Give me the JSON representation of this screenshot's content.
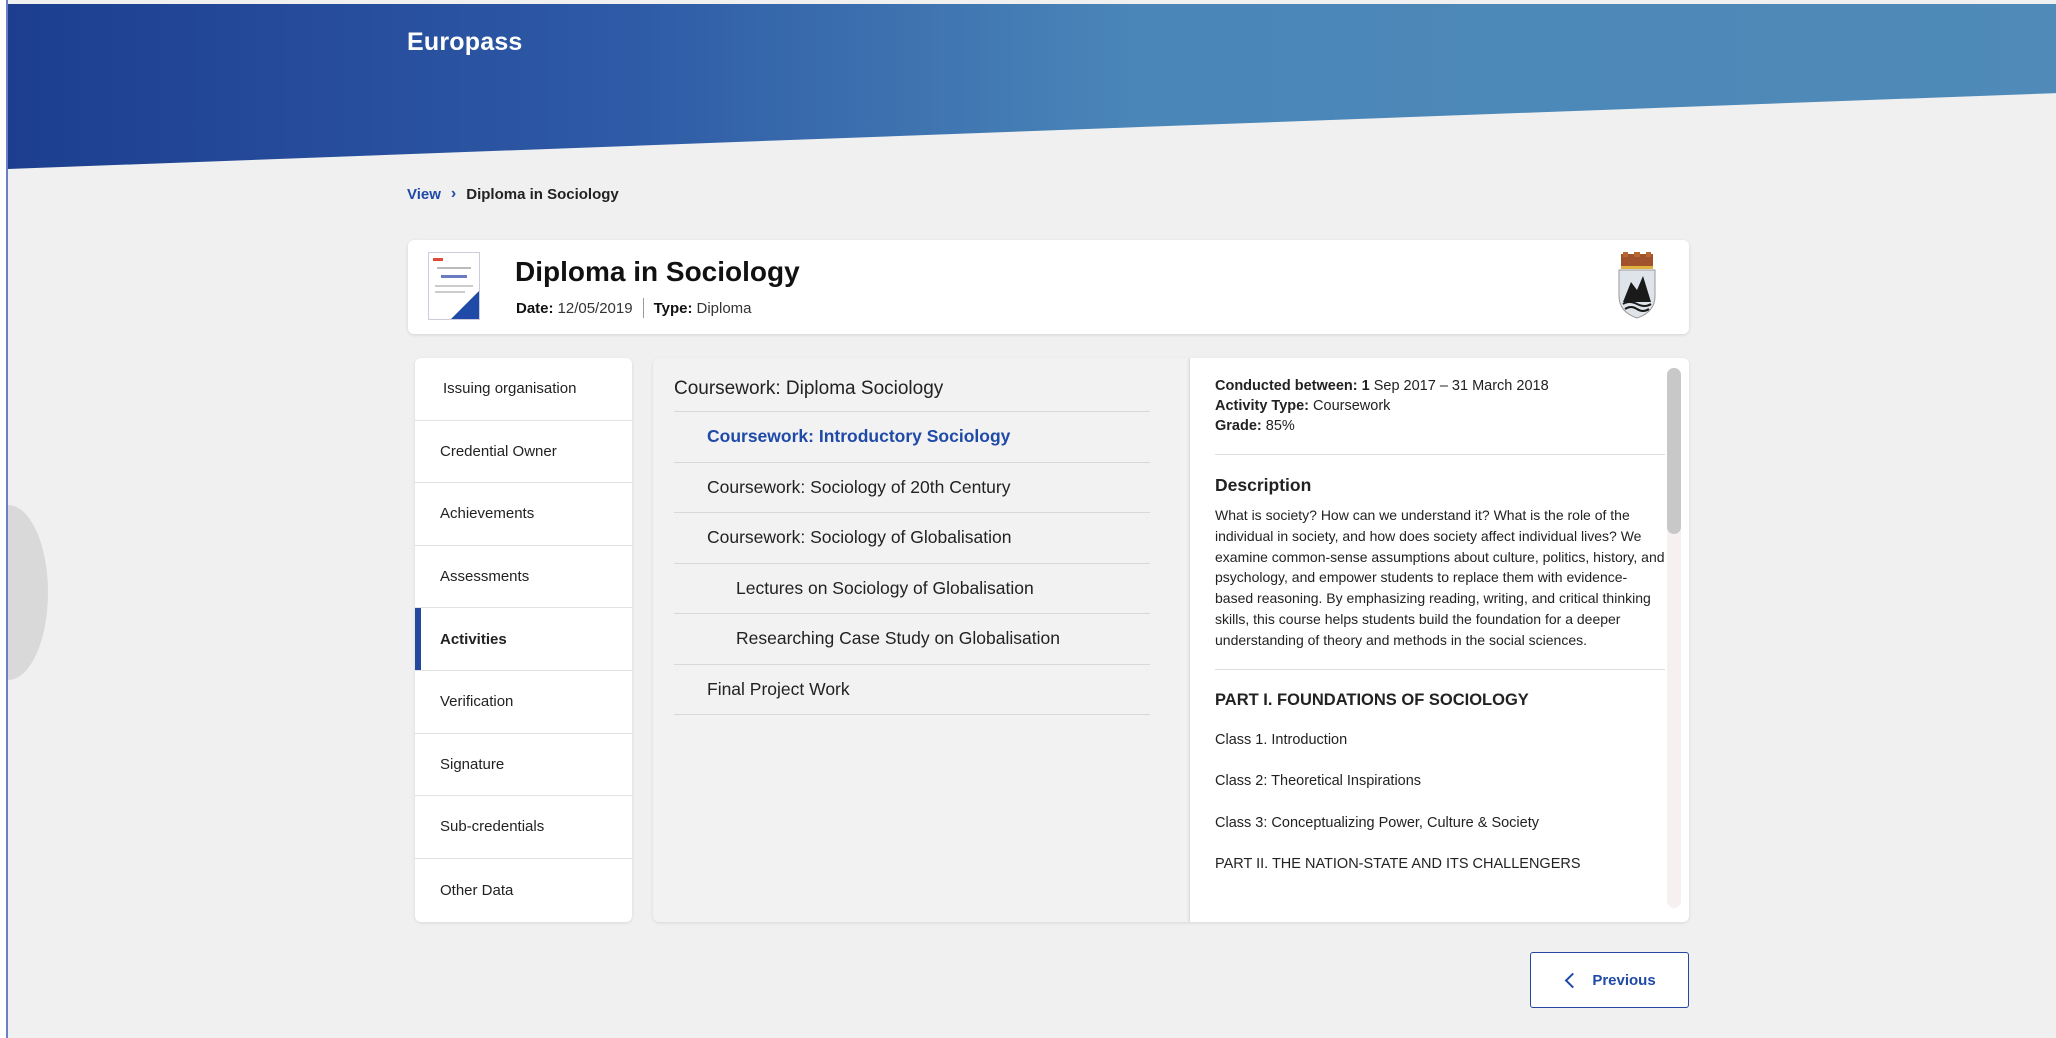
{
  "brand": {
    "name": "Europass"
  },
  "breadcrumb": {
    "link": "View",
    "separator": "›",
    "current": "Diploma in Sociology"
  },
  "credential": {
    "title": "Diploma in Sociology",
    "date_label": "Date:",
    "date_value": "12/05/2019",
    "type_label": "Type:",
    "type_value": "Diploma"
  },
  "nav": {
    "items": [
      {
        "label": "Issuing organisation",
        "active": false
      },
      {
        "label": "Credential Owner",
        "active": false
      },
      {
        "label": "Achievements",
        "active": false
      },
      {
        "label": "Assessments",
        "active": false
      },
      {
        "label": "Activities",
        "active": true
      },
      {
        "label": "Verification",
        "active": false
      },
      {
        "label": "Signature",
        "active": false
      },
      {
        "label": "Sub-credentials",
        "active": false
      },
      {
        "label": "Other Data",
        "active": false
      }
    ]
  },
  "tree": {
    "root": "Coursework: Diploma Sociology",
    "items": [
      {
        "label": "Coursework: Introductory Sociology",
        "level": 1,
        "selected": true
      },
      {
        "label": "Coursework: Sociology of 20th Century",
        "level": 1,
        "selected": false
      },
      {
        "label": "Coursework: Sociology of Globalisation",
        "level": 1,
        "selected": false
      },
      {
        "label": "Lectures on Sociology of Globalisation",
        "level": 2,
        "selected": false
      },
      {
        "label": "Researching Case Study on Globalisation",
        "level": 2,
        "selected": false
      },
      {
        "label": "Final Project Work",
        "level": 1,
        "selected": false
      }
    ]
  },
  "detail": {
    "conducted_label": "Conducted between:",
    "conducted_value_bold": " 1",
    "conducted_value": " Sep 2017 – 31 March 2018",
    "activity_type_label": "Activity Type:",
    "activity_type_value": " Coursework",
    "grade_label": "Grade:",
    "grade_value": " 85%",
    "description_title": "Description",
    "description_text": "What is society? How can we understand it? What is the role of the individual in society, and how does society affect individual lives? We examine common-sense assumptions about culture, politics, history, and psychology, and empower students to replace them with evidence-based reasoning. By emphasizing reading, writing, and critical thinking skills, this course helps students build the foundation for a deeper understanding of theory and methods in the social sciences.",
    "part1_title": "PART I. FOUNDATIONS OF SOCIOLOGY",
    "classes": [
      "Class 1. Introduction",
      "Class 2: Theoretical Inspirations",
      "Class 3: Conceptualizing Power, Culture & Society"
    ],
    "part2_title": "PART II. THE NATION-STATE AND ITS CHALLENGERS"
  },
  "buttons": {
    "previous": "Previous"
  },
  "colors": {
    "accent": "#1f4aa8",
    "header_start": "#1d3e8f",
    "header_end": "#4f8ab8"
  }
}
